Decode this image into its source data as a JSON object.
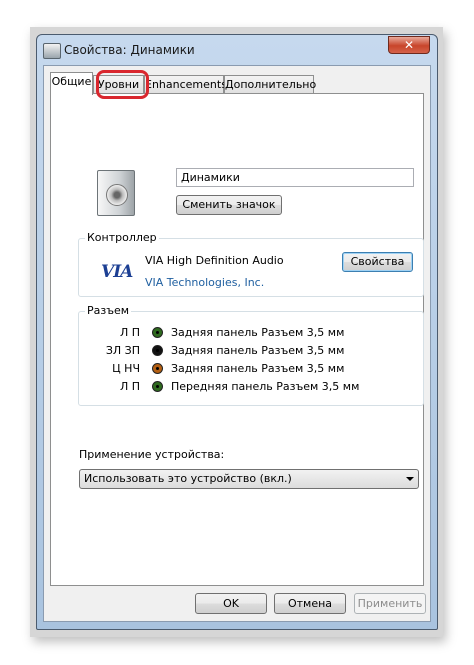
{
  "window": {
    "title": "Свойства: Динамики",
    "close_glyph": "✕"
  },
  "tabs": [
    {
      "label": "Общие"
    },
    {
      "label": "Уровни"
    },
    {
      "label": "Enhancements"
    },
    {
      "label": "Дополнительно"
    }
  ],
  "device": {
    "name_value": "Динамики",
    "change_icon_label": "Сменить значок"
  },
  "controller": {
    "group_title": "Контроллер",
    "logo_text": "VIA",
    "name": "VIA High Definition Audio",
    "vendor_link": "VIA Technologies, Inc.",
    "properties_label": "Свойства"
  },
  "jacks": {
    "group_title": "Разъем",
    "rows": [
      {
        "channels": "Л П",
        "color": "#2f6a1f",
        "text": "Задняя панель Разъем 3,5 мм"
      },
      {
        "channels": "ЗЛ ЗП",
        "color": "#111111",
        "text": "Задняя панель Разъем 3,5 мм"
      },
      {
        "channels": "Ц НЧ",
        "color": "#b35f13",
        "text": "Задняя панель Разъем 3,5 мм"
      },
      {
        "channels": "Л П",
        "color": "#2f6a1f",
        "text": "Передняя панель Разъем 3,5 мм"
      }
    ]
  },
  "usage": {
    "label": "Применение устройства:",
    "selected": "Использовать это устройство (вкл.)"
  },
  "buttons": {
    "ok": "OK",
    "cancel": "Отмена",
    "apply": "Применить"
  },
  "colors": {
    "highlight": "#d9272e",
    "link": "#1f5fa0",
    "window_frame": "#b9d1ea"
  }
}
